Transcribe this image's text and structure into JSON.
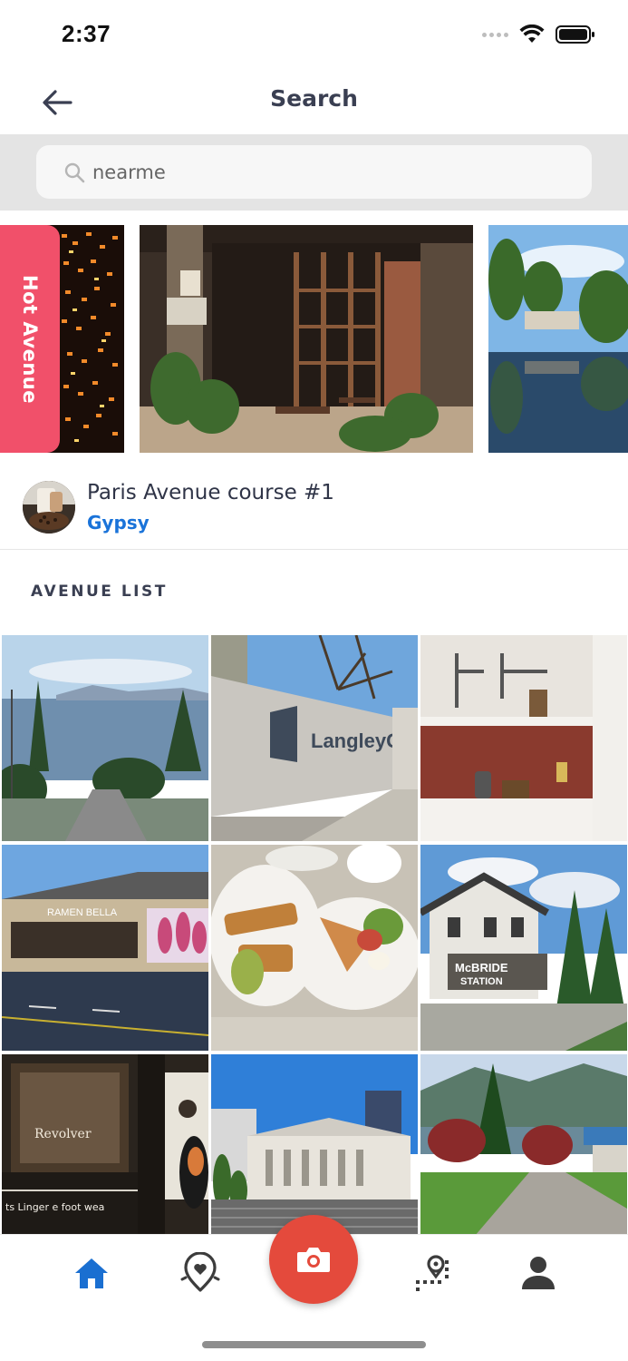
{
  "status_bar": {
    "time": "2:37"
  },
  "header": {
    "title": "Search",
    "back_icon": "arrow-left-icon"
  },
  "search": {
    "value": "nearme",
    "placeholder": ""
  },
  "carousel": {
    "hot_label": "Hot Avenue"
  },
  "course": {
    "title": "Paris Avenue course #1",
    "author": "Gypsy"
  },
  "section": {
    "title": "AVENUE LIST"
  },
  "bottom_nav": {
    "items": [
      "home-icon",
      "map-pin-heart-icon",
      "camera-icon",
      "route-icon",
      "person-icon"
    ],
    "active_color": "#1a6fd1",
    "inactive_color": "#3c3c3c"
  },
  "colors": {
    "accent_blue": "#1a73d9",
    "hot_pink": "#f1506a",
    "camera_red": "#e44a3c"
  }
}
